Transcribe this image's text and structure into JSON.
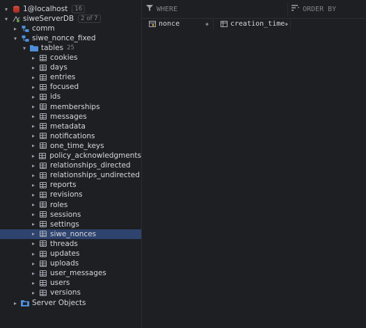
{
  "sidebar": {
    "connection": {
      "label": "1@localhost",
      "count": "16"
    },
    "database": {
      "label": "siweServerDB",
      "badge": "2 of 7"
    },
    "schema_comm": {
      "label": "comm"
    },
    "schema_siwe": {
      "label": "siwe_nonce_fixed"
    },
    "tables_folder": {
      "label": "tables",
      "count": "25"
    },
    "tables": [
      {
        "label": "cookies"
      },
      {
        "label": "days"
      },
      {
        "label": "entries"
      },
      {
        "label": "focused"
      },
      {
        "label": "ids"
      },
      {
        "label": "memberships"
      },
      {
        "label": "messages"
      },
      {
        "label": "metadata"
      },
      {
        "label": "notifications"
      },
      {
        "label": "one_time_keys"
      },
      {
        "label": "policy_acknowledgments"
      },
      {
        "label": "relationships_directed"
      },
      {
        "label": "relationships_undirected"
      },
      {
        "label": "reports"
      },
      {
        "label": "revisions"
      },
      {
        "label": "roles"
      },
      {
        "label": "sessions"
      },
      {
        "label": "settings"
      },
      {
        "label": "siwe_nonces",
        "selected": true
      },
      {
        "label": "threads"
      },
      {
        "label": "updates"
      },
      {
        "label": "uploads"
      },
      {
        "label": "user_messages"
      },
      {
        "label": "users"
      },
      {
        "label": "versions"
      }
    ],
    "server_objects": {
      "label": "Server Objects"
    }
  },
  "filter": {
    "where_label": "WHERE",
    "order_label": "ORDER BY"
  },
  "columns": [
    {
      "label": "nonce"
    },
    {
      "label": "creation_time"
    }
  ],
  "colors": {
    "selected_row": "#2e436e",
    "db_icon": "#d9534f",
    "schema_icon": "#4f8fd9",
    "folder_icon": "#4f8fd9"
  }
}
